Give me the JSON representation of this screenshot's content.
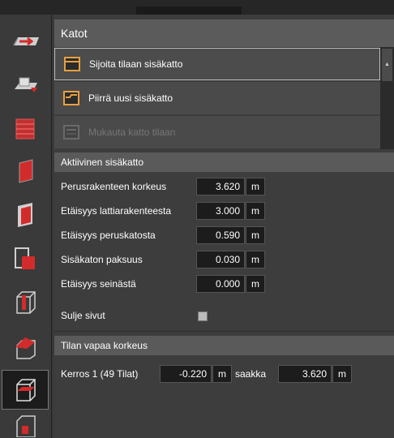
{
  "header": {
    "title": "Katot"
  },
  "menu": {
    "items": [
      {
        "label": "Sijoita tilaan sisäkatto",
        "icon": "ceiling-place-icon"
      },
      {
        "label": "Piirrä uusi sisäkatto",
        "icon": "ceiling-draw-icon"
      },
      {
        "label": "Mukauta katto tilaan",
        "icon": "ceiling-adjust-icon",
        "disabled": true
      }
    ]
  },
  "active_ceiling": {
    "title": "Aktiivinen sisäkatto",
    "fields": [
      {
        "label": "Perusrakenteen korkeus",
        "value": "3.620",
        "unit": "m"
      },
      {
        "label": "Etäisyys lattiarakenteesta",
        "value": "3.000",
        "unit": "m"
      },
      {
        "label": "Etäisyys peruskatosta",
        "value": "0.590",
        "unit": "m"
      },
      {
        "label": "Sisäkaton paksuus",
        "value": "0.030",
        "unit": "m"
      },
      {
        "label": "Etäisyys seinästä",
        "value": "0.000",
        "unit": "m"
      }
    ],
    "close_sides_label": "Sulje sivut"
  },
  "free_height": {
    "title": "Tilan vapaa korkeus",
    "floor_label": "Kerros 1 (49 Tilat)",
    "from_value": "-0.220",
    "from_unit": "m",
    "to_label": "saakka",
    "to_value": "3.620",
    "to_unit": "m"
  },
  "colors": {
    "accent_orange": "#e8a040",
    "tool_red": "#d22b2b"
  }
}
